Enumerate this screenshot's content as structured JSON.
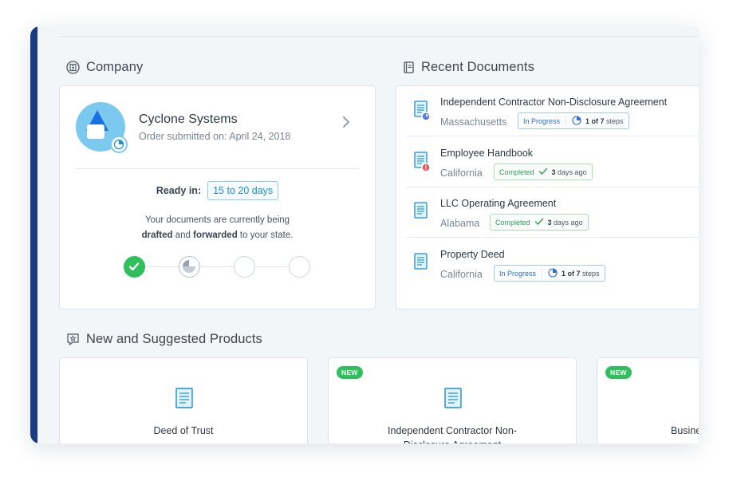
{
  "company_section": {
    "title": "Company",
    "name": "Cyclone Systems",
    "order_label": "Order submitted on: April 24, 2018",
    "ready_label": "Ready in:",
    "ready_value": "15 to 20 days",
    "message_line1": "Your documents are currently being",
    "message_drafted": "drafted",
    "message_and": " and ",
    "message_forwarded": "forwarded",
    "message_end": " to your state.",
    "progress_steps": [
      "complete",
      "in-progress",
      "pending",
      "pending"
    ]
  },
  "recent_documents": {
    "title": "Recent Documents",
    "items": [
      {
        "title": "Independent Contractor Non-Disclosure Agreement",
        "state": "Massachusetts",
        "status": "In Progress",
        "meta_bold": "1 of 7",
        "meta_rest": " steps",
        "badge": "pie-icon"
      },
      {
        "title": "Employee Handbook",
        "state": "California",
        "status": "Completed",
        "meta_bold": "3",
        "meta_rest": " days ago",
        "badge": "alert-icon"
      },
      {
        "title": "LLC Operating Agreement",
        "state": "Alabama",
        "status": "Completed",
        "meta_bold": "3",
        "meta_rest": " days ago",
        "badge": ""
      },
      {
        "title": "Property Deed",
        "state": "California",
        "status": "In Progress",
        "meta_bold": "1 of 7",
        "meta_rest": " steps",
        "badge": ""
      }
    ]
  },
  "products": {
    "title": "New and Suggested Products",
    "items": [
      {
        "title": "Deed of Trust",
        "badge": ""
      },
      {
        "title": "Independent Contractor Non-Disclosure Agreement",
        "badge": "NEW"
      },
      {
        "title": "Business",
        "badge": "NEW"
      }
    ]
  },
  "colors": {
    "accent_bar": "#1b3c80",
    "complete_green": "#2fbf5c",
    "progress_blue": "#2e6fcb",
    "avatar_bg": "#7cc9ef",
    "doc_icon": "#1a8fd0"
  }
}
